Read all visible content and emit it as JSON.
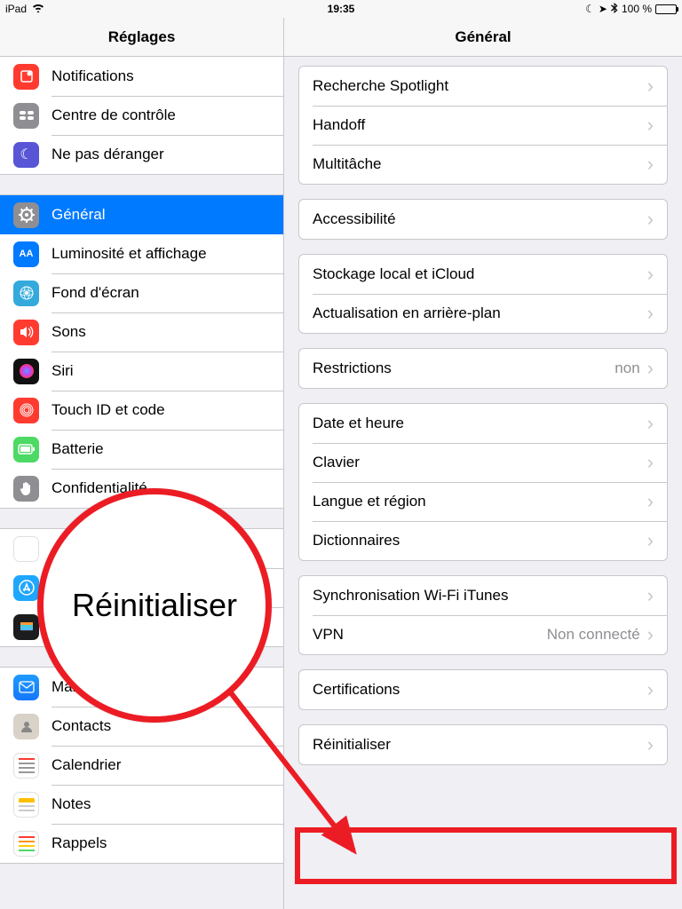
{
  "status": {
    "device": "iPad",
    "time": "19:35",
    "battery": "100 %"
  },
  "sidebar": {
    "title": "Réglages",
    "g1": [
      {
        "label": "Notifications"
      },
      {
        "label": "Centre de contrôle"
      },
      {
        "label": "Ne pas déranger"
      }
    ],
    "g2": [
      {
        "label": "Général"
      },
      {
        "label": "Luminosité et affichage"
      },
      {
        "label": "Fond d'écran"
      },
      {
        "label": "Sons"
      },
      {
        "label": "Siri"
      },
      {
        "label": "Touch ID et code"
      },
      {
        "label": "Batterie"
      },
      {
        "label": "Confidentialité"
      }
    ],
    "g3": [
      {
        "label": ""
      },
      {
        "label": ""
      },
      {
        "label": ""
      }
    ],
    "g4": [
      {
        "label": "Mail"
      },
      {
        "label": "Contacts"
      },
      {
        "label": "Calendrier"
      },
      {
        "label": "Notes"
      },
      {
        "label": "Rappels"
      }
    ]
  },
  "detail": {
    "title": "Général",
    "g1": [
      {
        "label": "Recherche Spotlight"
      },
      {
        "label": "Handoff"
      },
      {
        "label": "Multitâche"
      }
    ],
    "g2": [
      {
        "label": "Accessibilité"
      }
    ],
    "g3": [
      {
        "label": "Stockage local et iCloud"
      },
      {
        "label": "Actualisation en arrière-plan"
      }
    ],
    "g4": [
      {
        "label": "Restrictions",
        "value": "non"
      }
    ],
    "g5": [
      {
        "label": "Date et heure"
      },
      {
        "label": "Clavier"
      },
      {
        "label": "Langue et région"
      },
      {
        "label": "Dictionnaires"
      }
    ],
    "g6": [
      {
        "label": "Synchronisation Wi-Fi iTunes"
      },
      {
        "label": "VPN",
        "value": "Non connecté"
      }
    ],
    "g7": [
      {
        "label": "Certifications"
      }
    ],
    "g8": [
      {
        "label": "Réinitialiser"
      }
    ]
  },
  "annotation": {
    "zoom_text": "Réinitialiser"
  }
}
